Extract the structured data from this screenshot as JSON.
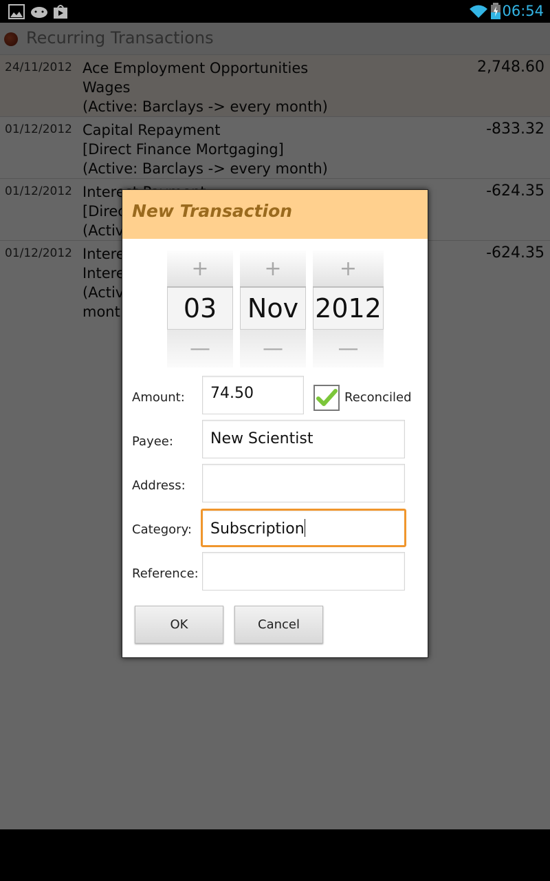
{
  "status_bar": {
    "time": "06:54",
    "left_icons": [
      "gallery-icon",
      "android-icon",
      "play-store-icon"
    ],
    "right_icons": [
      "wifi-icon",
      "battery-charging-icon"
    ],
    "accent_color": "#33b5e5"
  },
  "app": {
    "title": "Recurring Transactions"
  },
  "transactions": [
    {
      "date": "24/11/2012",
      "description": "Ace Employment Opportunities\nWages\n(Active: Barclays -> every month)",
      "amount": "2,748.60"
    },
    {
      "date": "01/12/2012",
      "description": "Capital Repayment\n[Direct Finance Mortgaging]\n(Active: Barclays -> every month)",
      "amount": "-833.32"
    },
    {
      "date": "01/12/2012",
      "description": "Interest Payment\n[Direc\n(Activ",
      "amount": "-624.35"
    },
    {
      "date": "01/12/2012",
      "description": "Intere\nIntere\n(Activ\nmont",
      "amount": "-624.35"
    }
  ],
  "dialog": {
    "title": "New Transaction",
    "header_color": "#ffd08e",
    "date_picker": {
      "day": "03",
      "month": "Nov",
      "year": "2012",
      "increment_symbol": "+",
      "decrement_symbol": "—"
    },
    "amount": {
      "label": "Amount:",
      "value": "74.50"
    },
    "reconciled": {
      "label": "Reconciled",
      "checked": true
    },
    "payee": {
      "label": "Payee:",
      "value": "New Scientist"
    },
    "address": {
      "label": "Address:",
      "value": ""
    },
    "category": {
      "label": "Category:",
      "value": "Subscription"
    },
    "reference": {
      "label": "Reference:",
      "value": ""
    },
    "ok_label": "OK",
    "cancel_label": "Cancel",
    "focus_color": "#f0962d"
  }
}
